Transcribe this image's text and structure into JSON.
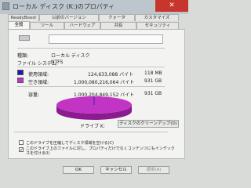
{
  "window": {
    "title": "ローカル ディスク (K:)のプロパティ",
    "close_glyph": "✕"
  },
  "tabs_back": [
    {
      "label": "ReadyBoost"
    },
    {
      "label": "以前のバージョン"
    },
    {
      "label": "クォータ"
    },
    {
      "label": "カスタマイズ"
    }
  ],
  "tabs_front": [
    {
      "label": "全般"
    },
    {
      "label": "ツール"
    },
    {
      "label": "ハードウェア"
    },
    {
      "label": "共有"
    },
    {
      "label": "セキュリティ"
    }
  ],
  "general": {
    "drive_name_value": "",
    "type_label": "種類:",
    "type_value": "ローカル ディスク",
    "fs_label": "ファイル システム:",
    "fs_value": "NTFS",
    "used_label": "使用領域:",
    "used_bytes": "124,633,088 バイト",
    "used_size": "118 MB",
    "free_label": "空き領域:",
    "free_bytes": "1,000,080,216,064 バイト",
    "free_size": "931 GB",
    "capacity_label": "容量:",
    "capacity_bytes": "1,000,204,849,152 バイト",
    "capacity_size": "931 GB",
    "drive_label": "ドライブ K:",
    "cleanup_button": "ディスクのクリーンアップ(D)",
    "compress_label": "このドライブを圧縮してディスク領域を空ける(C)",
    "index_label": "このドライブ上のファイルに対し、プロパティだけでなくコンテンツにもインデックスを付ける(I)"
  },
  "colors": {
    "used": "#1d1bb5",
    "free": "#c531c6",
    "pie_top": "#c235c4",
    "pie_side": "#8a1c8f"
  },
  "pie": {
    "used_fraction": 0.0001
  },
  "buttons": {
    "ok": "OK",
    "cancel": "キャンセル",
    "apply": "適用(A)"
  },
  "checkboxes": {
    "compress_checked": false,
    "index_checked": true,
    "index_mark": "✓"
  }
}
